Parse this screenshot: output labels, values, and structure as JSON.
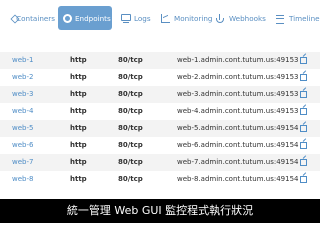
{
  "tabs": [
    {
      "label": "Containers",
      "icon": "cube-icon",
      "active": false
    },
    {
      "label": "Endpoints",
      "icon": "globe-icon",
      "active": true
    },
    {
      "label": "Logs",
      "icon": "monitor-icon",
      "active": false
    },
    {
      "label": "Monitoring",
      "icon": "chart-icon",
      "active": false
    },
    {
      "label": "Webhooks",
      "icon": "hook-icon",
      "active": false
    },
    {
      "label": "Timeline",
      "icon": "list-icon",
      "active": false
    }
  ],
  "colors": {
    "accent": "#6a9fd0",
    "link": "#4f8dc6",
    "row_alt": "#f3f3f3"
  },
  "endpoints": [
    {
      "name": "web-1",
      "protocol": "http",
      "port": "80/tcp",
      "url": "web-1.admin.cont.tutum.us:49153"
    },
    {
      "name": "web-2",
      "protocol": "http",
      "port": "80/tcp",
      "url": "web-2.admin.cont.tutum.us:49153"
    },
    {
      "name": "web-3",
      "protocol": "http",
      "port": "80/tcp",
      "url": "web-3.admin.cont.tutum.us:49153"
    },
    {
      "name": "web-4",
      "protocol": "http",
      "port": "80/tcp",
      "url": "web-4.admin.cont.tutum.us:49153"
    },
    {
      "name": "web-5",
      "protocol": "http",
      "port": "80/tcp",
      "url": "web-5.admin.cont.tutum.us:49154"
    },
    {
      "name": "web-6",
      "protocol": "http",
      "port": "80/tcp",
      "url": "web-6.admin.cont.tutum.us:49154"
    },
    {
      "name": "web-7",
      "protocol": "http",
      "port": "80/tcp",
      "url": "web-7.admin.cont.tutum.us:49154"
    },
    {
      "name": "web-8",
      "protocol": "http",
      "port": "80/tcp",
      "url": "web-8.admin.cont.tutum.us:49154"
    }
  ],
  "caption": "統一管理 Web GUI 監控程式執行狀況"
}
